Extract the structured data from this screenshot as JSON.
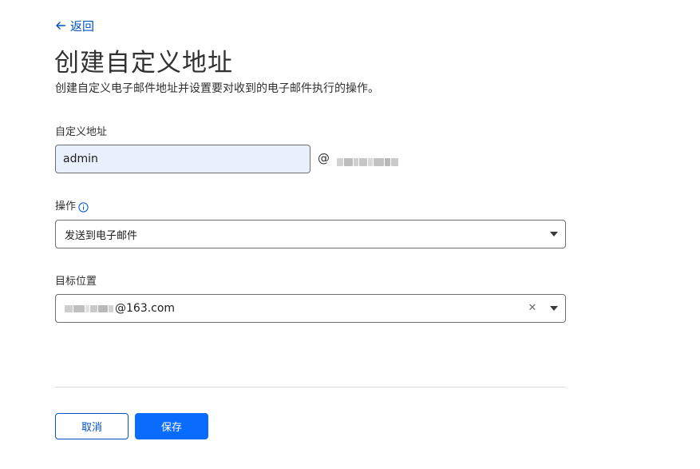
{
  "nav": {
    "back_label": "返回",
    "back_icon": "arrow-left-icon"
  },
  "header": {
    "title": "创建自定义地址",
    "subtitle": "创建自定义电子邮件地址并设置要对收到的电子邮件执行的操作。"
  },
  "custom_address": {
    "label": "自定义地址",
    "value": "admin",
    "at_symbol": "@"
  },
  "action": {
    "label": "操作",
    "info_icon": "info-icon",
    "selected": "发送到电子邮件"
  },
  "destination": {
    "label": "目标位置",
    "selected_visible_suffix": "@163.com",
    "clear_icon": "close-icon"
  },
  "footer": {
    "cancel_label": "取消",
    "save_label": "保存"
  },
  "colors": {
    "link": "#0051c3",
    "primary": "#0a6cff",
    "autofill_bg": "#e8f0fe",
    "border": "#6e6e6e",
    "divider": "#d9d9d9"
  }
}
